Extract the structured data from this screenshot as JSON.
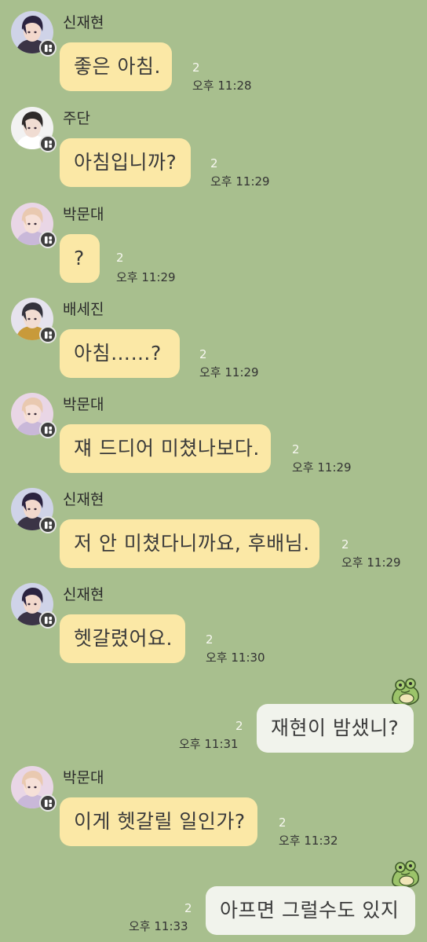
{
  "messages": [
    {
      "side": "in",
      "sender": "신재현",
      "avatar": "avatar-jaehyun",
      "text": "좋은 아침.",
      "unread": "2",
      "time": "오후 11:28"
    },
    {
      "side": "in",
      "sender": "주단",
      "avatar": "avatar-judan",
      "text": "아침입니까?",
      "unread": "2",
      "time": "오후 11:29"
    },
    {
      "side": "in",
      "sender": "박문대",
      "avatar": "avatar-moondae",
      "text": "?",
      "unread": "2",
      "time": "오후 11:29"
    },
    {
      "side": "in",
      "sender": "배세진",
      "avatar": "avatar-sejin",
      "text": "아침……?",
      "unread": "2",
      "time": "오후 11:29"
    },
    {
      "side": "in",
      "sender": "박문대",
      "avatar": "avatar-moondae",
      "text": "쟤 드디어 미쳤나보다.",
      "unread": "2",
      "time": "오후 11:29"
    },
    {
      "side": "in",
      "sender": "신재현",
      "avatar": "avatar-jaehyun",
      "text": "저 안 미쳤다니까요, 후배님.",
      "unread": "2",
      "time": "오후 11:29"
    },
    {
      "side": "in",
      "sender": "신재현",
      "avatar": "avatar-jaehyun",
      "text": "헷갈렸어요.",
      "unread": "2",
      "time": "오후 11:30"
    },
    {
      "side": "out",
      "text": "재현이 밤샜니?",
      "unread": "2",
      "time": "오후 11:31",
      "sticker": "frog-sticker-icon"
    },
    {
      "side": "in",
      "sender": "박문대",
      "avatar": "avatar-moondae",
      "text": "이게 헷갈릴 일인가?",
      "unread": "2",
      "time": "오후 11:32"
    },
    {
      "side": "out",
      "text": "아프면 그럴수도 있지",
      "unread": "2",
      "time": "오후 11:33",
      "sticker": "frog-sticker-icon"
    }
  ],
  "colors": {
    "background": "#a8bf8e",
    "incoming_bubble": "#fbe8a6",
    "outgoing_bubble": "#f1f3ec",
    "unread_count": "#f7f7f0"
  }
}
